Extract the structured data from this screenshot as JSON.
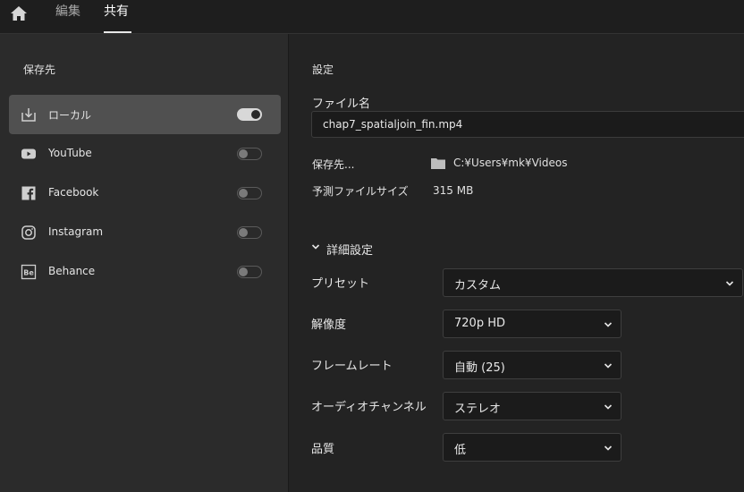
{
  "topbar": {
    "home_icon": "home-icon",
    "tabs": [
      {
        "label": "編集",
        "active": false
      },
      {
        "label": "共有",
        "active": true
      }
    ]
  },
  "sidebar": {
    "title": "保存先",
    "destinations": [
      {
        "label": "ローカル",
        "icon": "download-icon",
        "enabled": true,
        "selected": true
      },
      {
        "label": "YouTube",
        "icon": "youtube-icon",
        "enabled": false,
        "selected": false
      },
      {
        "label": "Facebook",
        "icon": "facebook-icon",
        "enabled": false,
        "selected": false
      },
      {
        "label": "Instagram",
        "icon": "instagram-icon",
        "enabled": false,
        "selected": false
      },
      {
        "label": "Behance",
        "icon": "behance-icon",
        "enabled": false,
        "selected": false
      }
    ]
  },
  "settings": {
    "title": "設定",
    "filename_label": "ファイル名",
    "filename_value": "chap7_spatialjoin_fin.mp4",
    "location_label": "保存先...",
    "location_value": "C:¥Users¥mk¥Videos",
    "filesize_label": "予測ファイルサイズ",
    "filesize_value": "315 MB",
    "advanced_label": "詳細設定",
    "preset_label": "プリセット",
    "preset_value": "カスタム",
    "resolution_label": "解像度",
    "resolution_value": "720p HD",
    "framerate_label": "フレームレート",
    "framerate_value": "自動 (25)",
    "audio_label": "オーディオチャンネル",
    "audio_value": "ステレオ",
    "quality_label": "品質",
    "quality_value": "低"
  },
  "colors": {
    "background": "#232323",
    "sidebar": "#2b2b2b",
    "selected_item": "#505050",
    "input_bg": "#1b1b1b",
    "text": "#e8e8e8"
  }
}
